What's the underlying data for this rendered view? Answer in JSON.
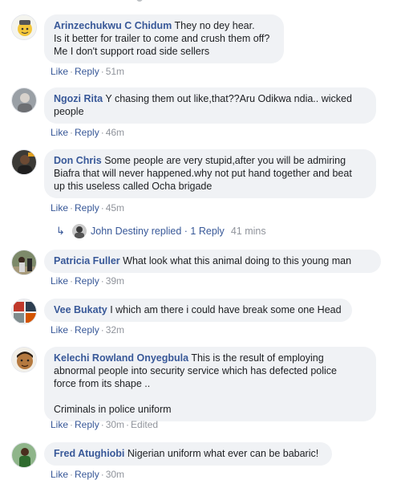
{
  "comments": [
    {
      "name": "Arinzechukwu C Chidum",
      "lines": [
        "They no dey hear.",
        "Is it better for trailer to come and crush them off?",
        "Me I don't support road side sellers"
      ],
      "like": "Like",
      "reply": "Reply",
      "time": "51m",
      "avatar": "avatar-cartoon-yellow"
    },
    {
      "name": "Ngozi Rita",
      "lines": [
        "Y chasing them out like,that??Aru Odikwa ndia.. wicked",
        "people"
      ],
      "like": "Like",
      "reply": "Reply",
      "time": "46m",
      "avatar": "avatar-gray-person"
    },
    {
      "name": "Don Chris",
      "lines": [
        "Some people are very stupid,after you will be admiring",
        "Biafra that will never happened.why not put hand together and beat",
        "up this useless called Ocha brigade"
      ],
      "like": "Like",
      "reply": "Reply",
      "time": "45m",
      "avatar": "avatar-dark-person"
    },
    {
      "name": "Patricia Fuller",
      "lines": [
        "What look what this animal doing to this young man"
      ],
      "like": "Like",
      "reply": "Reply",
      "time": "39m",
      "avatar": "avatar-outdoor"
    },
    {
      "name": "Vee Bukaty",
      "lines": [
        "I which am there i could have break some one Head"
      ],
      "like": "Like",
      "reply": "Reply",
      "time": "32m",
      "avatar": "avatar-collage"
    },
    {
      "name": "Kelechi Rowland Onyegbula",
      "lines": [
        "This is the result of employing",
        "abnormal people into security service which has defected police",
        "force from its shape ..",
        "",
        "Criminals in police uniform"
      ],
      "like": "Like",
      "reply": "Reply",
      "time": "30m",
      "edited": "Edited",
      "avatar": "avatar-cartoon-face"
    },
    {
      "name": "Fred Atughiobi",
      "lines": [
        "Nigerian uniform what ever can be babaric!"
      ],
      "like": "Like",
      "reply": "Reply",
      "time": "30m",
      "avatar": "avatar-green-person"
    }
  ],
  "reply_summary": {
    "name": "John Destiny",
    "replied": "replied",
    "sep": "·",
    "count": "1 Reply",
    "time": "41 mins",
    "arrow_icon": "reply-arrow-icon"
  },
  "colors": {
    "link": "#385898",
    "bubble": "#f0f2f5",
    "meta": "#90949c"
  }
}
